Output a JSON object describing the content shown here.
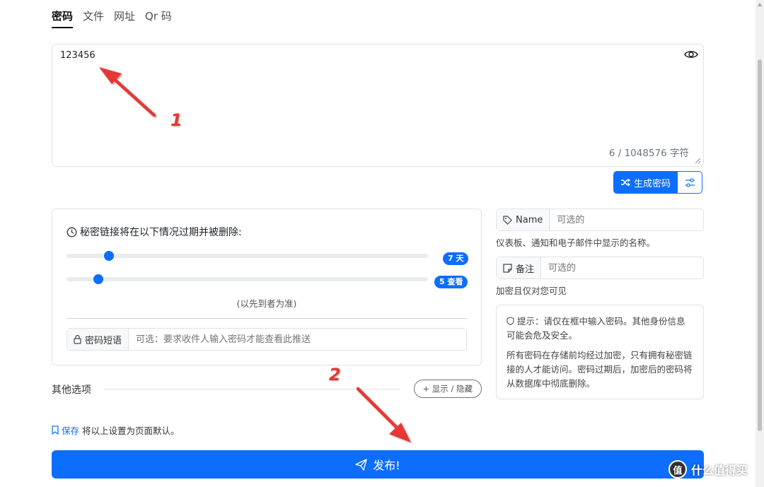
{
  "tabs": [
    {
      "label": "密码",
      "active": true
    },
    {
      "label": "文件",
      "active": false
    },
    {
      "label": "网址",
      "active": false
    },
    {
      "label": "Qr 码",
      "active": false
    }
  ],
  "secret": {
    "value": "123456",
    "char_count": "6 / 1048576 字符"
  },
  "generate": {
    "label": "生成密码"
  },
  "expiration": {
    "title": "秘密链接将在以下情况过期并被删除:",
    "days_badge": "7 天",
    "views_badge": "5 查看",
    "days_level": 0.08,
    "views_level": 0.05,
    "note": "(以先到者为准)",
    "passphrase_label": "密码短语",
    "passphrase_placeholder": "可选：要求收件人输入密码才能查看此推送"
  },
  "name_field": {
    "label": "Name",
    "placeholder": "可选的",
    "help": "仪表板、通知和电子邮件中显示的名称。"
  },
  "note_field": {
    "label": "备注",
    "placeholder": "可选的",
    "help": "加密且仅对您可见"
  },
  "tip": {
    "line1": "提示：请仅在框中输入密码。其他身份信息可能会危及安全。",
    "line2": "所有密码在存储前均经过加密，只有拥有秘密链接的人才能访问。密码过期后，加密后的密码将从数据库中彻底删除。"
  },
  "other_options": {
    "label": "其他选项",
    "toggle_label": "+ 显示 / 隐藏"
  },
  "save_default": {
    "link": "保存",
    "text": "将以上设置为页面默认。"
  },
  "publish": {
    "label": "发布!"
  },
  "annotations": {
    "first": "1",
    "second": "2",
    "color": "#e53935"
  },
  "watermark": {
    "logo_char": "值",
    "text": "什么值得买"
  },
  "colors": {
    "primary": "#0d6efd",
    "border": "#dee2e6"
  }
}
